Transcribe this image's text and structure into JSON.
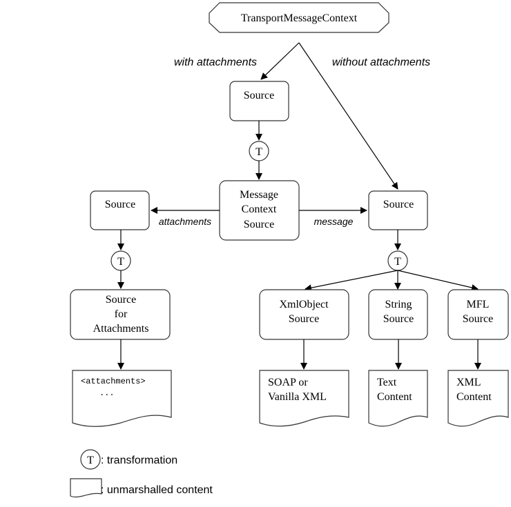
{
  "diagram": {
    "root": {
      "label": "TransportMessageContext"
    },
    "edge_labels": {
      "with_attachments": "with attachments",
      "without_attachments": "without attachments",
      "attachments": "attachments",
      "message": "message"
    },
    "nodes": {
      "source_top": {
        "lines": [
          "Source"
        ]
      },
      "transform_top": {
        "symbol": "T"
      },
      "message_context_source": {
        "lines": [
          "Message",
          "Context",
          "Source"
        ]
      },
      "source_left": {
        "lines": [
          "Source"
        ]
      },
      "source_right": {
        "lines": [
          "Source"
        ]
      },
      "transform_left": {
        "symbol": "T"
      },
      "transform_right": {
        "symbol": "T"
      },
      "source_for_attachments": {
        "lines": [
          "Source",
          "for",
          "Attachments"
        ]
      },
      "xmlobject_source": {
        "lines": [
          "XmlObject",
          "Source"
        ]
      },
      "string_source": {
        "lines": [
          "String",
          "Source"
        ]
      },
      "mfl_source": {
        "lines": [
          "MFL",
          "Source"
        ]
      }
    },
    "documents": {
      "attachments_doc": {
        "lines": [
          "<attachments>",
          "..."
        ]
      },
      "soap_doc": {
        "lines": [
          "SOAP or",
          "Vanilla XML"
        ]
      },
      "text_doc": {
        "lines": [
          "Text",
          "Content"
        ]
      },
      "xml_doc": {
        "lines": [
          "XML",
          "Content"
        ]
      }
    },
    "legend": {
      "transformation_symbol": "T",
      "transformation_label": ":  transformation",
      "content_label": ":  unmarshalled content"
    }
  }
}
